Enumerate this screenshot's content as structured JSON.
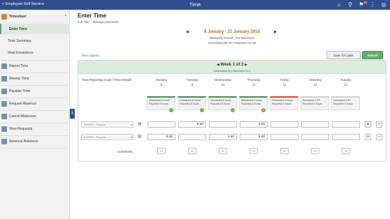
{
  "topbar": {
    "back_label": "< Employee Self Service",
    "title": "Time",
    "notification_count": "10"
  },
  "sidebar": {
    "section_title": "Timesheet",
    "section_items": [
      {
        "label": "Enter Time",
        "active": true
      },
      {
        "label": "Time Summary"
      },
      {
        "label": "View Exceptions"
      }
    ],
    "items": [
      {
        "label": "Report Time",
        "icon": "clipboard-icon"
      },
      {
        "label": "Weekly Time",
        "icon": "calendar-icon"
      },
      {
        "label": "Payable Time",
        "icon": "money-icon"
      },
      {
        "label": "Request Absence",
        "icon": "briefcase-icon"
      },
      {
        "label": "Cancel Absences",
        "icon": "cancel-icon"
      },
      {
        "label": "View Requests",
        "icon": "list-icon"
      },
      {
        "label": "Absence Balances",
        "icon": "scale-icon"
      }
    ]
  },
  "main": {
    "title": "Enter Time",
    "job_label": "Job Title",
    "job_value": "Manager Revenue",
    "period": "8 January - 21 January 2018",
    "period_type": "BiWeekly Period - PS Delivered",
    "scheduled_label": "Scheduled",
    "scheduled_value": "80.00",
    "reported_label": "Reported",
    "reported_value": "31.00",
    "legend_link": "View Legend",
    "save_label": "Save for Later",
    "submit_label": "Submit",
    "week_label": "Week 1 of 2",
    "week_summary": "Scheduled 40 | Reported 31.0",
    "column_label": "Time Reporting Code / Time Details",
    "days": [
      {
        "name": "Monday",
        "date": "8",
        "sched": "Scheduled 8 hours",
        "rep": "Reported 8 hours",
        "status": "green"
      },
      {
        "name": "Tuesday",
        "date": "9",
        "sched": "Scheduled 8 hours",
        "rep": "Reported 8 hours",
        "status": "green"
      },
      {
        "name": "Wednesday",
        "date": "10",
        "sched": "Scheduled 8 hours",
        "rep": "Reported 8 hours",
        "status": "green"
      },
      {
        "name": "Thursday",
        "date": "11",
        "sched": "Scheduled 8 hours",
        "rep": "Reported 8 hours",
        "status": "green"
      },
      {
        "name": "Friday",
        "date": "12",
        "sched": "Scheduled 8 hours",
        "rep": "Reported 0 hours",
        "status": "red"
      },
      {
        "name": "Saturday",
        "date": "13",
        "sched": "Scheduled OFF",
        "rep": "Reported 0 hours",
        "status": "grey"
      },
      {
        "name": "Sunday",
        "date": "14",
        "sched": "Scheduled OFF",
        "rep": "Reported 0 hours",
        "status": "grey"
      }
    ],
    "rows": [
      {
        "trc": "KURED - Regular",
        "values": [
          "",
          "8.00",
          "",
          "4.00",
          "",
          "",
          ""
        ]
      },
      {
        "trc": "KURED - Regular",
        "values": [
          "8.00",
          "",
          "1.50",
          "3.00",
          "",
          "",
          ""
        ]
      }
    ],
    "comments_label": "Comments"
  }
}
